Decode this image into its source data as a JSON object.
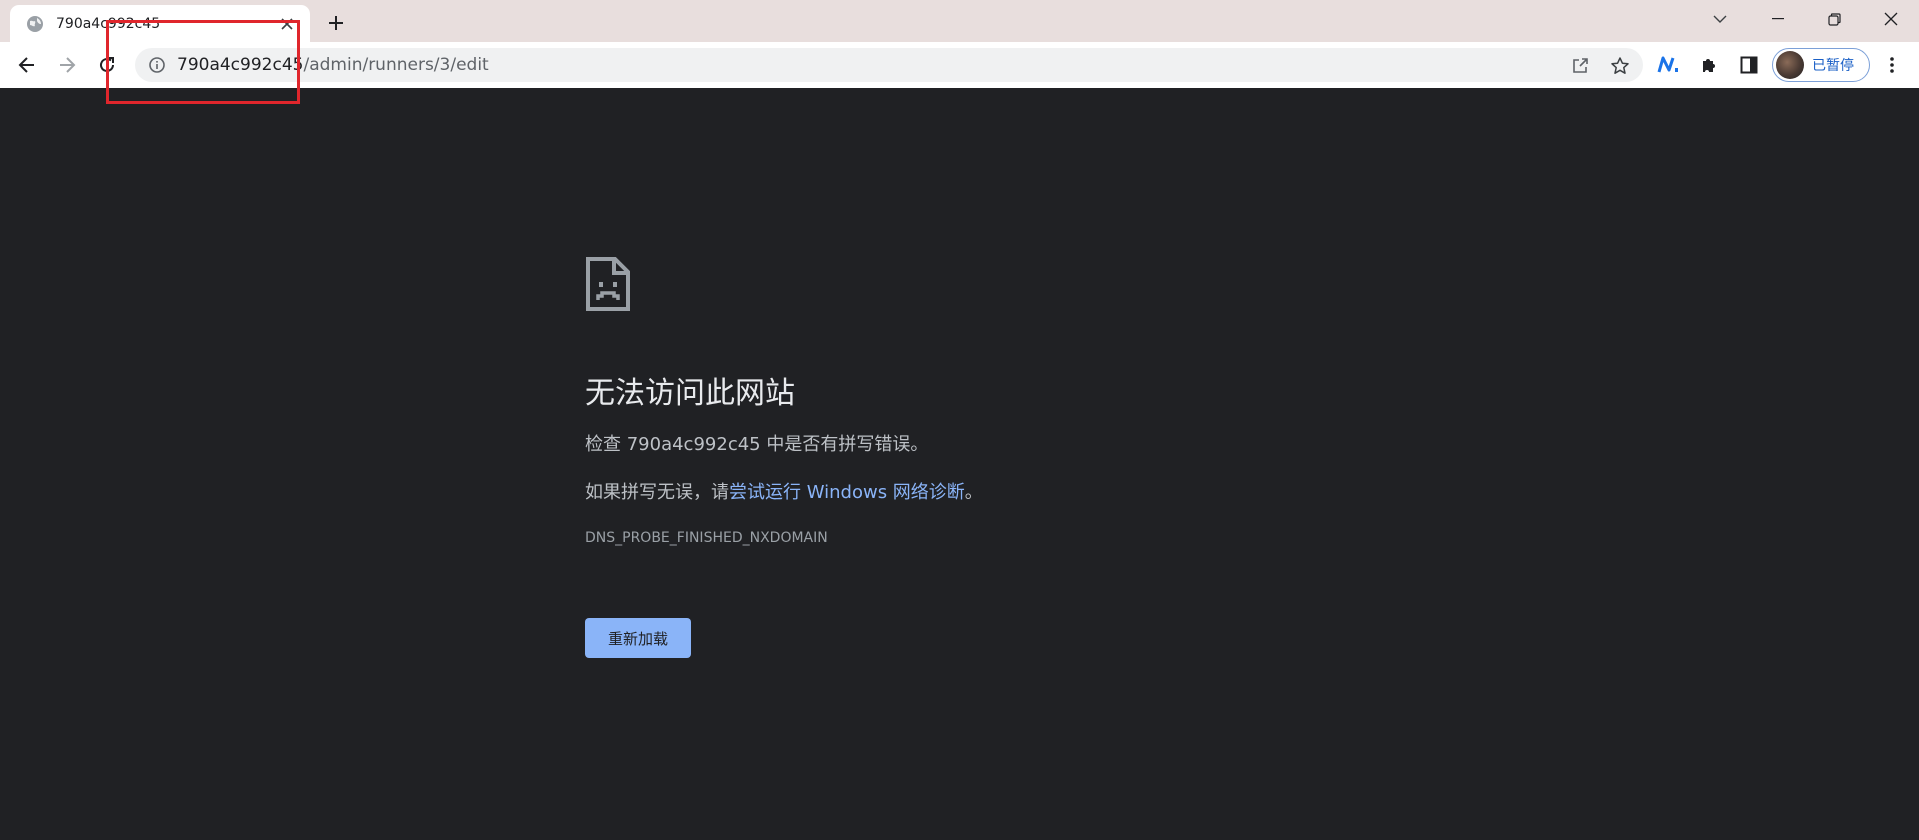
{
  "tab": {
    "title": "790a4c992c45",
    "favicon": "globe-icon",
    "close_icon": "close-icon"
  },
  "new_tab_icon": "plus-icon",
  "window_controls": [
    "chevron-down-icon",
    "minimize-icon",
    "restore-icon",
    "close-icon"
  ],
  "toolbar": {
    "back_icon": "back-arrow-icon",
    "forward_icon": "forward-arrow-icon",
    "reload_icon": "reload-icon"
  },
  "omnibox": {
    "host": "790a4c992c45",
    "path": "/admin/runners/3/edit",
    "info_icon": "info-icon",
    "share_icon": "share-icon",
    "bookmark_icon": "star-icon"
  },
  "extensions": [
    "extension-n-icon",
    "puzzle-icon",
    "side-panel-icon"
  ],
  "profile": {
    "label": "已暂停",
    "accent": "#1a5fc6"
  },
  "error": {
    "icon": "sad-document-icon",
    "title": "无法访问此网站",
    "check_line": "检查 790a4c992c45 中是否有拼写错误。",
    "suggest_prefix": "如果拼写无误，请",
    "suggest_link": "尝试运行 Windows 网络诊断",
    "suggest_suffix": "。",
    "code": "DNS_PROBE_FINISHED_NXDOMAIN",
    "reload_label": "重新加载",
    "link_color": "#8ab4f8",
    "button_color": "#8ab4f8"
  },
  "annotation_color": "#e0262c"
}
